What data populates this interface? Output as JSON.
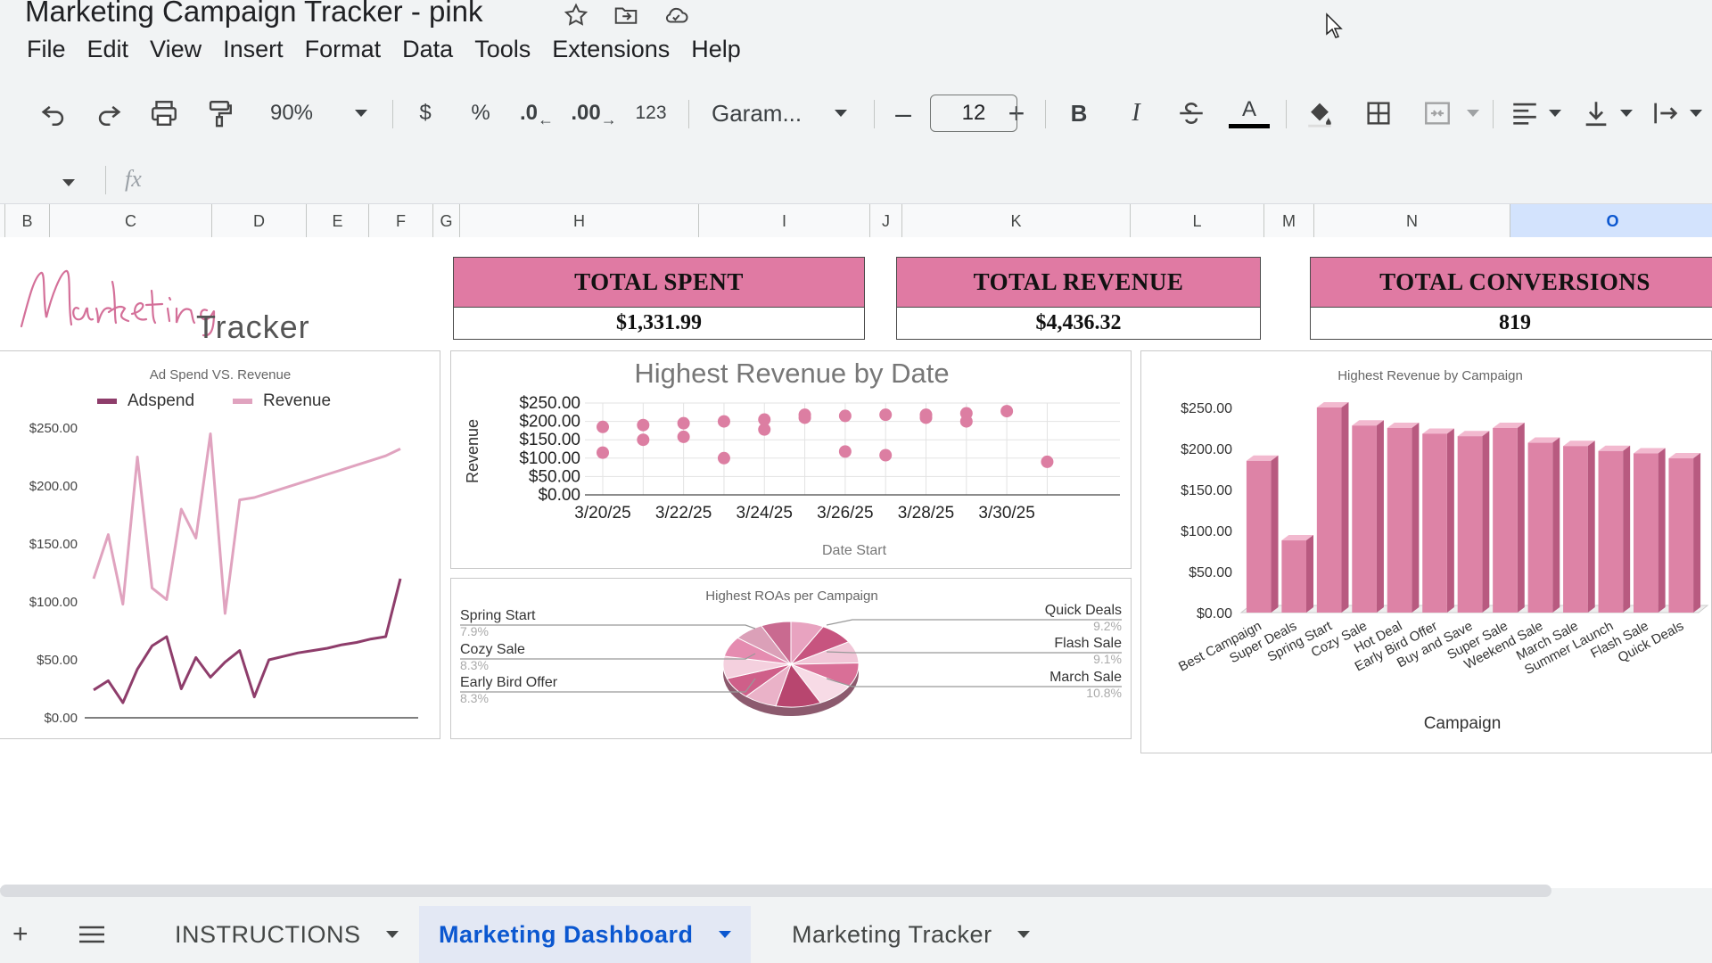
{
  "app": {
    "doc_title": "Marketing Campaign Tracker - pink",
    "menu": [
      "File",
      "Edit",
      "View",
      "Insert",
      "Format",
      "Data",
      "Tools",
      "Extensions",
      "Help"
    ]
  },
  "toolbar": {
    "zoom": "90%",
    "currency": "$",
    "percent": "%",
    "dec_decrease": ".0",
    "dec_increase": ".00",
    "number_format": "123",
    "font": "Garam...",
    "font_size": "12",
    "bold": "B",
    "italic": "I",
    "text_color_label": "A"
  },
  "formula_bar": {
    "fx": "fx"
  },
  "columns": [
    "B",
    "C",
    "D",
    "E",
    "F",
    "G",
    "H",
    "I",
    "J",
    "K",
    "L",
    "M",
    "N",
    "O"
  ],
  "selected_column": "O",
  "logo": {
    "script": "Marketing",
    "word": "Tracker"
  },
  "kpis": [
    {
      "label": "TOTAL SPENT",
      "value": "$1,331.99"
    },
    {
      "label": "TOTAL REVENUE",
      "value": "$4,436.32"
    },
    {
      "label": "TOTAL CONVERSIONS",
      "value": "819"
    }
  ],
  "charts": {
    "line": {
      "title": "Ad Spend VS. Revenue",
      "legend": [
        "Adspend",
        "Revenue"
      ],
      "yticks": [
        "$250.00",
        "$200.00",
        "$150.00",
        "$100.00",
        "$50.00",
        "$0.00"
      ]
    },
    "scatter": {
      "title": "Highest Revenue by Date",
      "ylabel": "Revenue",
      "xlabel": "Date Start",
      "yticks": [
        "$250.00",
        "$200.00",
        "$150.00",
        "$100.00",
        "$50.00",
        "$0.00"
      ],
      "xticks": [
        "3/20/25",
        "3/22/25",
        "3/24/25",
        "3/26/25",
        "3/28/25",
        "3/30/25"
      ]
    },
    "pie": {
      "title": "Highest ROAs per Campaign",
      "left_labels": [
        {
          "name": "Spring Start",
          "pct": "7.9%"
        },
        {
          "name": "Cozy Sale",
          "pct": "8.3%"
        },
        {
          "name": "Early Bird Offer",
          "pct": "8.3%"
        }
      ],
      "right_labels": [
        {
          "name": "Quick Deals",
          "pct": "9.2%"
        },
        {
          "name": "Flash Sale",
          "pct": "9.1%"
        },
        {
          "name": "March Sale",
          "pct": "10.8%"
        }
      ]
    },
    "bar": {
      "title": "Highest Revenue by Campaign",
      "xlabel": "Campaign",
      "yticks": [
        "$250.00",
        "$200.00",
        "$150.00",
        "$100.00",
        "$50.00",
        "$0.00"
      ]
    }
  },
  "chart_data": [
    {
      "type": "line",
      "title": "Ad Spend VS. Revenue",
      "ylim": [
        0,
        250
      ],
      "legend": "top",
      "grid": false,
      "series": [
        {
          "name": "Adspend",
          "color": "#8e3d6b",
          "values": [
            24,
            32,
            13,
            42,
            62,
            70,
            25,
            52,
            35,
            48,
            58,
            18,
            50,
            53,
            56,
            58,
            60,
            63,
            65,
            68,
            70,
            120
          ]
        },
        {
          "name": "Revenue",
          "color": "#e0a3bf",
          "values": [
            120,
            158,
            98,
            225,
            112,
            102,
            180,
            155,
            245,
            90,
            188,
            190,
            194,
            198,
            202,
            206,
            210,
            214,
            218,
            222,
            226,
            232
          ]
        }
      ]
    },
    {
      "type": "scatter",
      "title": "Highest Revenue by Date",
      "xlabel": "Date Start",
      "ylabel": "Revenue",
      "ylim": [
        0,
        250
      ],
      "xticks": [
        "3/20/25",
        "3/22/25",
        "3/24/25",
        "3/26/25",
        "3/28/25",
        "3/30/25"
      ],
      "points": [
        {
          "x": "3/20/25",
          "y": 185
        },
        {
          "x": "3/20/25",
          "y": 115
        },
        {
          "x": "3/21/25",
          "y": 190
        },
        {
          "x": "3/21/25",
          "y": 150
        },
        {
          "x": "3/22/25",
          "y": 195
        },
        {
          "x": "3/22/25",
          "y": 158
        },
        {
          "x": "3/23/25",
          "y": 200
        },
        {
          "x": "3/23/25",
          "y": 100
        },
        {
          "x": "3/24/25",
          "y": 205
        },
        {
          "x": "3/24/25",
          "y": 178
        },
        {
          "x": "3/25/25",
          "y": 218
        },
        {
          "x": "3/25/25",
          "y": 210
        },
        {
          "x": "3/26/25",
          "y": 215
        },
        {
          "x": "3/26/25",
          "y": 118
        },
        {
          "x": "3/27/25",
          "y": 218
        },
        {
          "x": "3/27/25",
          "y": 108
        },
        {
          "x": "3/28/25",
          "y": 218
        },
        {
          "x": "3/28/25",
          "y": 210
        },
        {
          "x": "3/29/25",
          "y": 222
        },
        {
          "x": "3/29/25",
          "y": 200
        },
        {
          "x": "3/30/25",
          "y": 228
        },
        {
          "x": "3/31/25",
          "y": 90
        }
      ]
    },
    {
      "type": "pie",
      "title": "Highest ROAs per Campaign",
      "slices": [
        {
          "label": "Spring Start",
          "value": 7.9
        },
        {
          "label": "Cozy Sale",
          "value": 8.3
        },
        {
          "label": "Early Bird Offer",
          "value": 8.3
        },
        {
          "label": "Quick Deals",
          "value": 9.2
        },
        {
          "label": "Flash Sale",
          "value": 9.1
        },
        {
          "label": "March Sale",
          "value": 10.8
        },
        {
          "label": "",
          "value": 7.9
        },
        {
          "label": "",
          "value": 8.1
        },
        {
          "label": "",
          "value": 8.4
        },
        {
          "label": "",
          "value": 7.6
        },
        {
          "label": "",
          "value": 7.2
        },
        {
          "label": "",
          "value": 7.2
        }
      ]
    },
    {
      "type": "bar",
      "title": "Highest Revenue by Campaign",
      "xlabel": "Campaign",
      "ylim": [
        0,
        250
      ],
      "categories": [
        "Best Campaign",
        "Super Deals",
        "Spring Start",
        "Cozy Sale",
        "Hot Deal",
        "Early Bird Offer",
        "Buy and Save",
        "Super Sale",
        "Weekend Sale",
        "March Sale",
        "Summer Launch",
        "Flash Sale",
        "Quick Deals"
      ],
      "values": [
        185,
        88,
        250,
        228,
        225,
        218,
        215,
        225,
        207,
        203,
        197,
        194,
        188
      ]
    }
  ],
  "sheets": [
    {
      "label": "INSTRUCTIONS",
      "active": false
    },
    {
      "label": "Marketing Dashboard",
      "active": true
    },
    {
      "label": "Marketing Tracker",
      "active": false
    }
  ]
}
